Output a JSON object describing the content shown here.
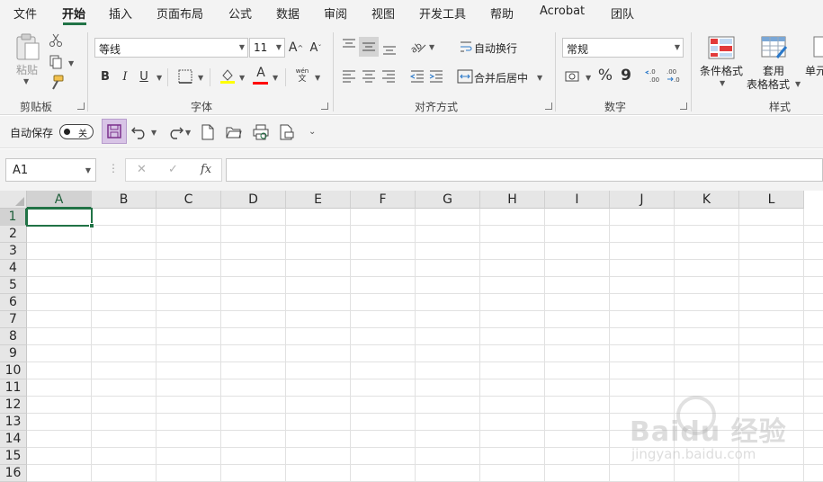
{
  "menu": {
    "tabs": [
      "文件",
      "开始",
      "插入",
      "页面布局",
      "公式",
      "数据",
      "审阅",
      "视图",
      "开发工具",
      "帮助",
      "Acrobat",
      "团队"
    ],
    "active": "开始"
  },
  "ribbon": {
    "clipboard": {
      "paste_label": "粘贴",
      "group_label": "剪贴板"
    },
    "font": {
      "font_name": "等线",
      "font_size": "11",
      "grow": "A^",
      "shrink": "A˅",
      "bold": "B",
      "italic": "I",
      "underline": "U",
      "phonetic": "wén 文",
      "group_label": "字体"
    },
    "alignment": {
      "wrap_text": "自动换行",
      "merge_center": "合并后居中",
      "group_label": "对齐方式"
    },
    "number": {
      "format": "常规",
      "percent": "%",
      "comma": "9",
      "inc_decimal": "←.0 .00",
      "dec_decimal": ".00 →.0",
      "group_label": "数字"
    },
    "styles": {
      "conditional": "条件格式",
      "table_format_1": "套用",
      "table_format_2": "表格格式",
      "cell_styles": "单元",
      "group_label": "样式"
    },
    "colors": {
      "highlight": "#ffff00",
      "font_color": "#ff0000",
      "accent": "#217346"
    }
  },
  "qat": {
    "autosave_label": "自动保存",
    "toggle_state": "关"
  },
  "formula_bar": {
    "name_box": "A1",
    "cancel": "✕",
    "enter": "✓",
    "fx": "fx",
    "content": ""
  },
  "grid": {
    "columns": [
      "A",
      "B",
      "C",
      "D",
      "E",
      "F",
      "G",
      "H",
      "I",
      "J",
      "K",
      "L"
    ],
    "rows": [
      "1",
      "2",
      "3",
      "4",
      "5",
      "6",
      "7",
      "8",
      "9",
      "10",
      "11",
      "12",
      "13",
      "14",
      "15",
      "16"
    ],
    "active_cell": "A1"
  },
  "watermark": {
    "brand": "Baidu 经验",
    "url": "jingyan.baidu.com"
  }
}
